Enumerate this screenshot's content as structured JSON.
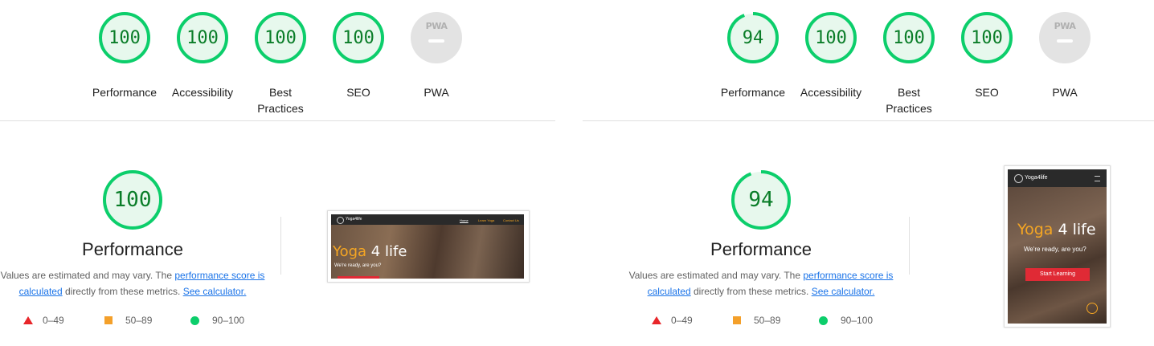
{
  "colors": {
    "pass": "#0cce6b",
    "pass_text": "#0a7d28",
    "pass_bg": "#e7f8ed",
    "average": "#f4a02a",
    "fail": "#e8262a",
    "link": "#1a73e8",
    "pwa_gray": "#e3e3e3"
  },
  "left": {
    "gauges": [
      {
        "label": "Performance",
        "score": 100
      },
      {
        "label": "Accessibility",
        "score": 100
      },
      {
        "label": "Best Practices",
        "score": 100
      },
      {
        "label": "SEO",
        "score": 100
      },
      {
        "label": "PWA",
        "badge": "PWA",
        "icon": "pwa-dash-icon"
      }
    ],
    "performance": {
      "score": 100,
      "title": "Performance",
      "desc_prefix": "Values are estimated and may vary. The ",
      "desc_link1": "performance score is calculated",
      "desc_middle": " directly from these metrics. ",
      "desc_link2": "See calculator."
    },
    "legend": [
      {
        "icon": "red-triangle-icon",
        "range": "0–49"
      },
      {
        "icon": "orange-square-icon",
        "range": "50–89"
      },
      {
        "icon": "green-circle-icon",
        "range": "90–100"
      }
    ],
    "screenshot": {
      "brand": "Yoga4life",
      "nav_links": [
        "Home",
        "Learn Yoga",
        "Contact Us"
      ],
      "hero_title_a": "Yoga",
      "hero_title_b": " 4 life",
      "hero_sub": "We're ready, are you?"
    }
  },
  "right": {
    "gauges": [
      {
        "label": "Performance",
        "score": 94
      },
      {
        "label": "Accessibility",
        "score": 100
      },
      {
        "label": "Best Practices",
        "score": 100
      },
      {
        "label": "SEO",
        "score": 100
      },
      {
        "label": "PWA",
        "badge": "PWA",
        "icon": "pwa-dash-icon"
      }
    ],
    "performance": {
      "score": 94,
      "title": "Performance",
      "desc_prefix": "Values are estimated and may vary. The ",
      "desc_link1": "performance score is calculated",
      "desc_middle": " directly from these metrics. ",
      "desc_link2": "See calculator."
    },
    "legend": [
      {
        "icon": "red-triangle-icon",
        "range": "0–49"
      },
      {
        "icon": "orange-square-icon",
        "range": "50–89"
      },
      {
        "icon": "green-circle-icon",
        "range": "90–100"
      }
    ],
    "screenshot": {
      "brand": "Yoga4life",
      "hero_title_a": "Yoga",
      "hero_title_b": " 4 life",
      "hero_sub": "We're ready, are you?",
      "cta": "Start Learning"
    }
  }
}
